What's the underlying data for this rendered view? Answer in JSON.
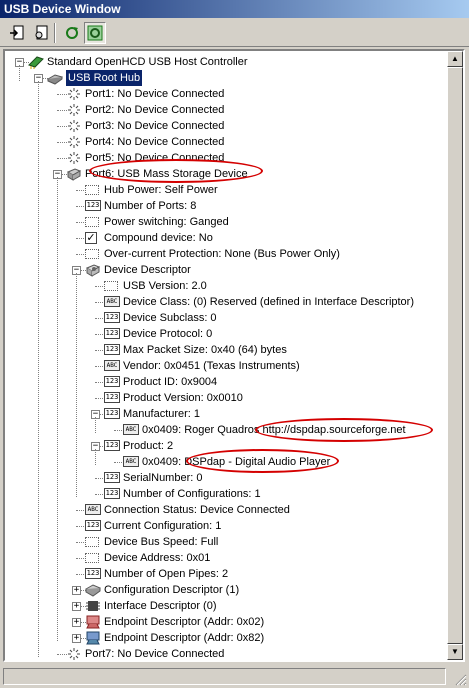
{
  "window": {
    "title": "USB Device Window"
  },
  "toolbar": {
    "buttons": [
      {
        "name": "export-icon",
        "pressed": false
      },
      {
        "name": "properties-icon",
        "pressed": false
      },
      {
        "name": "refresh-icon",
        "pressed": false
      },
      {
        "name": "auto-refresh-icon",
        "pressed": true
      }
    ]
  },
  "tree": [
    {
      "level": 0,
      "label": "Standard OpenHCD USB Host Controller",
      "icon": "controller-icon",
      "expand": "minus"
    },
    {
      "level": 1,
      "label": "USB Root Hub",
      "icon": "hub-icon",
      "expand": "minus",
      "selected": true
    },
    {
      "level": 2,
      "label": "Port1: No Device Connected",
      "icon": "port-empty-icon"
    },
    {
      "level": 2,
      "label": "Port2: No Device Connected",
      "icon": "port-empty-icon"
    },
    {
      "level": 2,
      "label": "Port3: No Device Connected",
      "icon": "port-empty-icon"
    },
    {
      "level": 2,
      "label": "Port4: No Device Connected",
      "icon": "port-empty-icon"
    },
    {
      "level": 2,
      "label": "Port5: No Device Connected",
      "icon": "port-empty-icon"
    },
    {
      "level": 2,
      "label": "Port6: USB Mass Storage Device",
      "icon": "device-icon",
      "expand": "minus"
    },
    {
      "level": 3,
      "label": "Hub Power: Self Power",
      "icon": "dots-icon"
    },
    {
      "level": 3,
      "label": "Number of Ports: 8",
      "icon": "number-icon"
    },
    {
      "level": 3,
      "label": "Power switching: Ganged",
      "icon": "dots-icon"
    },
    {
      "level": 3,
      "label": "Compound device: No",
      "icon": "checkbox-icon"
    },
    {
      "level": 3,
      "label": "Over-current Protection: None (Bus Power Only)",
      "icon": "dots-icon"
    },
    {
      "level": 3,
      "label": "Device Descriptor",
      "icon": "descriptor-icon",
      "expand": "minus"
    },
    {
      "level": 4,
      "label": "USB Version: 2.0",
      "icon": "dots-icon"
    },
    {
      "level": 4,
      "label": "Device Class: (0) Reserved (defined in Interface Descriptor)",
      "icon": "abc-icon"
    },
    {
      "level": 4,
      "label": "Device Subclass: 0",
      "icon": "number-icon"
    },
    {
      "level": 4,
      "label": "Device Protocol: 0",
      "icon": "number-icon"
    },
    {
      "level": 4,
      "label": "Max Packet Size: 0x40 (64) bytes",
      "icon": "number-icon"
    },
    {
      "level": 4,
      "label": "Vendor: 0x0451 (Texas Instruments)",
      "icon": "abc-icon"
    },
    {
      "level": 4,
      "label": "Product ID: 0x9004",
      "icon": "number-icon"
    },
    {
      "level": 4,
      "label": "Product Version: 0x0010",
      "icon": "number-icon"
    },
    {
      "level": 4,
      "label": "Manufacturer: 1",
      "icon": "number-icon",
      "expand": "minus"
    },
    {
      "level": 5,
      "label": "0x0409: Roger Quadros http://dspdap.sourceforge.net",
      "icon": "abc-icon"
    },
    {
      "level": 4,
      "label": "Product: 2",
      "icon": "number-icon",
      "expand": "minus"
    },
    {
      "level": 5,
      "label": "0x0409: DSPdap - Digital Audio Player",
      "icon": "abc-icon"
    },
    {
      "level": 4,
      "label": "SerialNumber: 0",
      "icon": "number-icon"
    },
    {
      "level": 4,
      "label": "Number of Configurations: 1",
      "icon": "number-icon"
    },
    {
      "level": 3,
      "label": "Connection Status: Device Connected",
      "icon": "abc-icon"
    },
    {
      "level": 3,
      "label": "Current Configuration: 1",
      "icon": "number-icon"
    },
    {
      "level": 3,
      "label": "Device Bus Speed: Full",
      "icon": "dots-icon"
    },
    {
      "level": 3,
      "label": "Device Address: 0x01",
      "icon": "dots-icon"
    },
    {
      "level": 3,
      "label": "Number of Open Pipes: 2",
      "icon": "number-icon"
    },
    {
      "level": 3,
      "label": "Configuration Descriptor (1)",
      "icon": "config-icon",
      "expand": "plus"
    },
    {
      "level": 3,
      "label": "Interface Descriptor (0)",
      "icon": "interface-icon",
      "expand": "plus"
    },
    {
      "level": 3,
      "label": "Endpoint Descriptor (Addr: 0x02)",
      "icon": "endpoint-out-icon",
      "expand": "plus"
    },
    {
      "level": 3,
      "label": "Endpoint Descriptor (Addr: 0x82)",
      "icon": "endpoint-in-icon",
      "expand": "plus"
    },
    {
      "level": 2,
      "label": "Port7: No Device Connected",
      "icon": "port-empty-icon"
    }
  ],
  "annotation_color": "#d40000",
  "selection_color": "#0a246a"
}
